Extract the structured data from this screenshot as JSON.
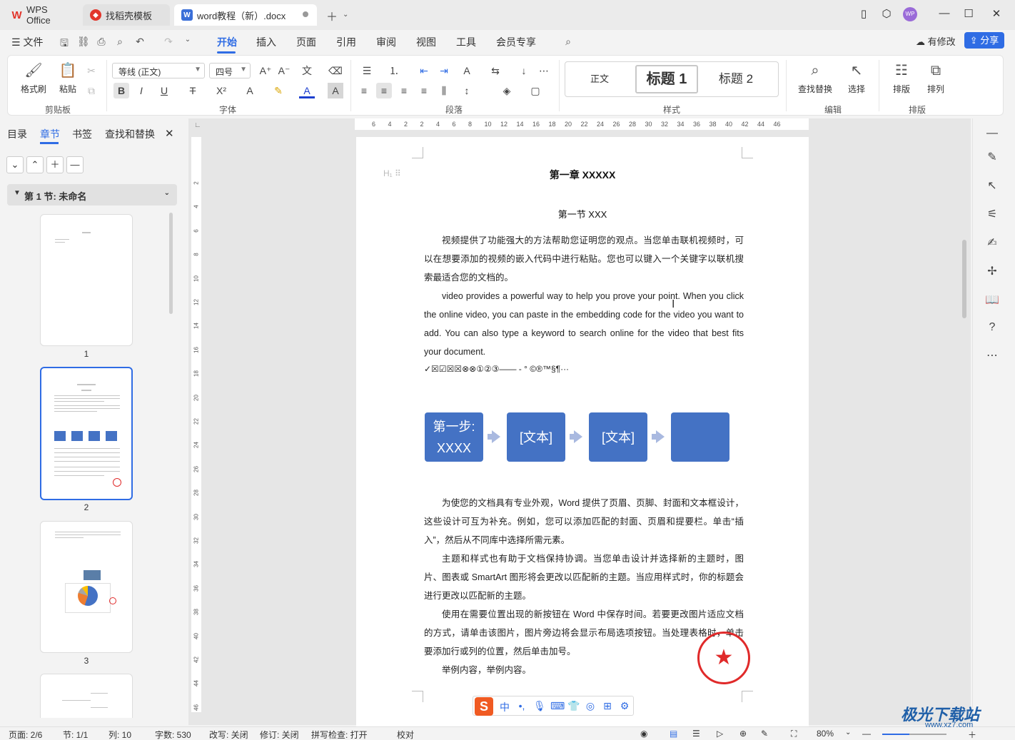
{
  "tabs": [
    {
      "label": "WPS Office"
    },
    {
      "label": "找稻壳模板"
    },
    {
      "label": "word教程（新）.docx"
    }
  ],
  "menu": {
    "file": "文件",
    "items": [
      "开始",
      "插入",
      "页面",
      "引用",
      "审阅",
      "视图",
      "工具",
      "会员专享"
    ],
    "modified": "有修改",
    "share": "分享"
  },
  "ribbon": {
    "clipboard": {
      "format_painter": "格式刷",
      "paste": "粘贴",
      "label": "剪贴板"
    },
    "font": {
      "family": "等线 (正文)",
      "size": "四号",
      "label": "字体"
    },
    "paragraph": {
      "label": "段落"
    },
    "styles": {
      "normal": "正文",
      "heading1": "标题 1",
      "heading2": "标题 2",
      "label": "样式"
    },
    "edit": {
      "find_replace": "查找替换",
      "select": "选择",
      "label": "编辑"
    },
    "arrange": {
      "layout": "排版",
      "order": "排列",
      "label": "排版"
    }
  },
  "nav": {
    "tabs": [
      "目录",
      "章节",
      "书签",
      "查找和替换"
    ],
    "section": "第 1 节: 未命名",
    "pages": [
      "1",
      "2",
      "3"
    ]
  },
  "ruler": {
    "h_ticks": [
      "6",
      "4",
      "2",
      "2",
      "4",
      "6",
      "8",
      "10",
      "12",
      "14",
      "16",
      "18",
      "20",
      "22",
      "24",
      "26",
      "28",
      "30",
      "32",
      "34",
      "36",
      "38",
      "40",
      "42",
      "44",
      "46"
    ],
    "v_ticks": [
      "2",
      "4",
      "6",
      "8",
      "10",
      "12",
      "14",
      "16",
      "18",
      "20",
      "22",
      "24",
      "26",
      "28",
      "30",
      "32",
      "34",
      "36",
      "38",
      "40",
      "42",
      "44",
      "46"
    ]
  },
  "document": {
    "title": "第一章  XXXXX",
    "subtitle": "第一节  XXX",
    "p1": "视频提供了功能强大的方法帮助您证明您的观点。当您单击联机视频时，可以在想要添加的视频的嵌入代码中进行粘贴。您也可以键入一个关键字以联机搜索最适合您的文档的。",
    "p2": "video provides a powerful way to help you prove your point. When you click the online video, you can paste in the embedding code for the video you want to add. You can also type a keyword to search online for the video that best fits your document.",
    "symbols": "✓☒☑☒☒⊗⊗①②③——  -     °  ©®™§¶···",
    "smartart": [
      "第一步:\nXXXX",
      "[文本]",
      "[文本]",
      ""
    ],
    "p3": "为使您的文档具有专业外观，Word 提供了页眉、页脚、封面和文本框设计，这些设计可互为补充。例如，您可以添加匹配的封面、页眉和提要栏。单击“插入”，然后从不同库中选择所需元素。",
    "p4": "主题和样式也有助于文档保持协调。当您单击设计并选择新的主题时，图片、图表或 SmartArt 图形将会更改以匹配新的主题。当应用样式时，你的标题会进行更改以匹配新的主题。",
    "p5": "使用在需要位置出现的新按钮在 Word 中保存时间。若要更改图片适应文档的方式，请单击该图片，图片旁边将会显示布局选项按钮。当处理表格时，单击要添加行或列的位置，然后单击加号。",
    "p6": "举例内容，举例内容。"
  },
  "status": {
    "page": "页面: 2/6",
    "section": "节: 1/1",
    "column": "列: 10",
    "words": "字数: 530",
    "overtype": "改写: 关闭",
    "track": "修订: 关闭",
    "spell": "拼写检查: 打开",
    "proof": "校对",
    "zoom": "80%",
    "zoom_level": 0.42
  },
  "watermark": {
    "text": "极光下载站",
    "url": "www.xz7.com"
  },
  "colors": {
    "accent": "#2f6ce4",
    "smartart": "#4472c4",
    "seal": "#e02a2a"
  }
}
